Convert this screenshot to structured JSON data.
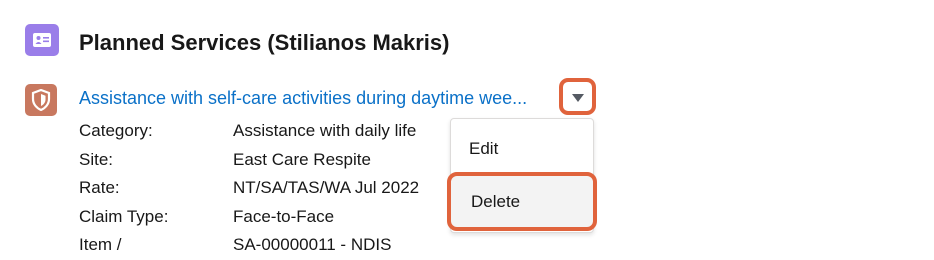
{
  "header": {
    "title": "Planned Services (Stilianos Makris)",
    "icon": "contact-card-icon",
    "icon_color": "#9a7ee9"
  },
  "record": {
    "icon": "shield-icon",
    "icon_color": "#c8785f",
    "link_text": "Assistance with self-care activities during daytime wee...",
    "link_color": "#0b71c8",
    "fields": [
      {
        "label": "Category:",
        "value": "Assistance with daily life"
      },
      {
        "label": "Site:",
        "value": "East Care Respite"
      },
      {
        "label": "Rate:",
        "value": "NT/SA/TAS/WA Jul 2022"
      },
      {
        "label": "Claim Type:",
        "value": "Face-to-Face"
      },
      {
        "label": "Item /",
        "value": "SA-00000011 - NDIS"
      }
    ]
  },
  "actions_menu": {
    "trigger_icon": "chevron-down-icon",
    "items": [
      {
        "label": "Edit"
      },
      {
        "label": "Delete"
      }
    ],
    "highlight_color": "#e0633c"
  }
}
